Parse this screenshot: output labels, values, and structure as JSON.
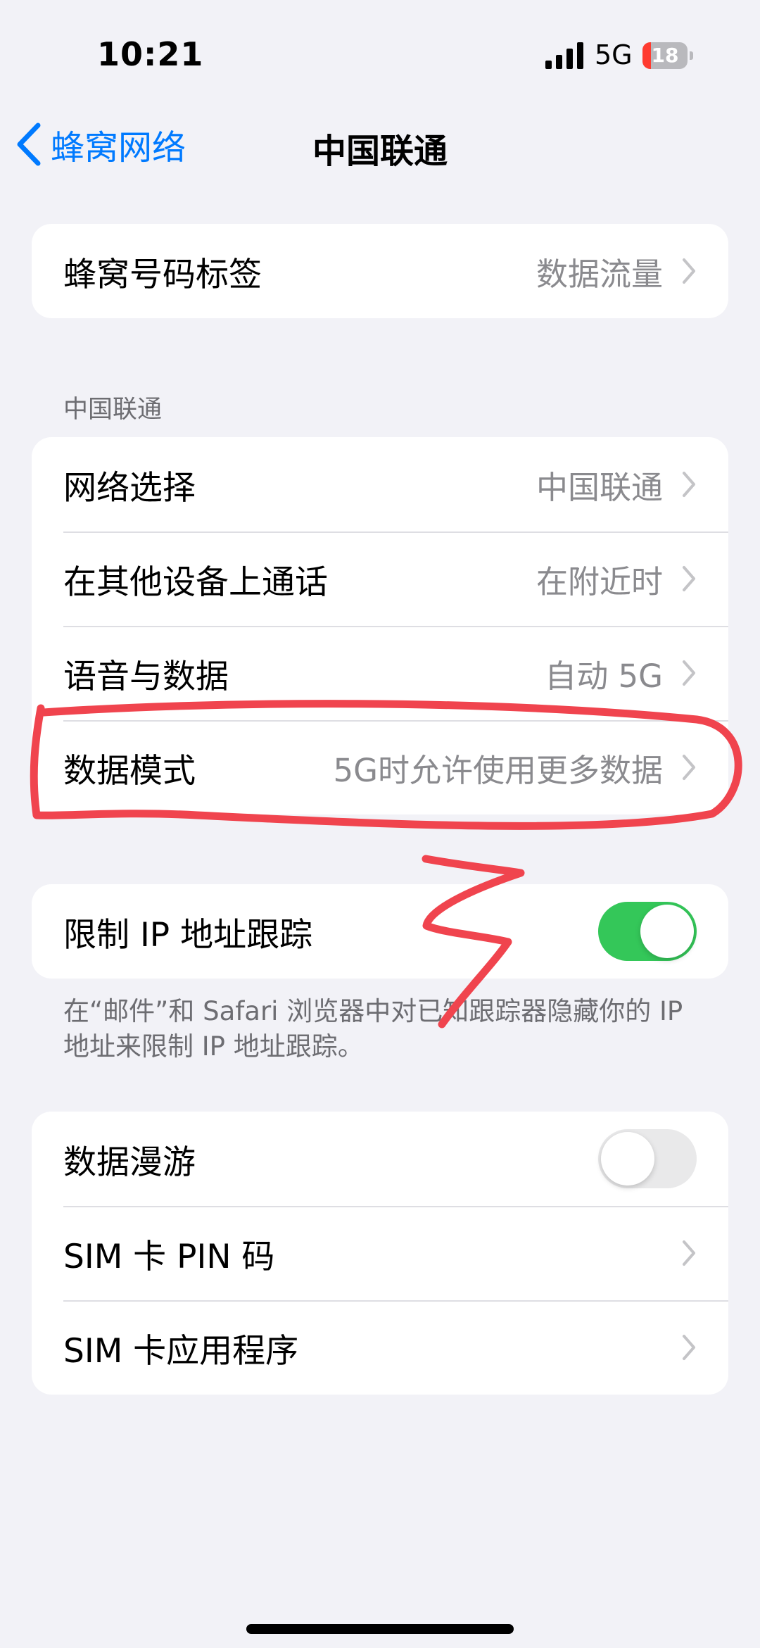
{
  "status_bar": {
    "time": "10:21",
    "network": "5G",
    "battery_level": "18",
    "battery_fraction": 0.18,
    "battery_color": "#ff3b30"
  },
  "nav": {
    "back_label": "蜂窝网络",
    "title": "中国联通"
  },
  "group1": {
    "rows": [
      {
        "label": "蜂窝号码标签",
        "value": "数据流量"
      }
    ]
  },
  "section2": {
    "header": "中国联通",
    "rows": [
      {
        "label": "网络选择",
        "value": "中国联通"
      },
      {
        "label": "在其他设备上通话",
        "value": "在附近时"
      },
      {
        "label": "语音与数据",
        "value": "自动 5G"
      },
      {
        "label": "数据模式",
        "value": "5G时允许使用更多数据"
      }
    ]
  },
  "section3": {
    "row": {
      "label": "限制 IP 地址跟踪",
      "toggle": "on"
    },
    "footer": "在“邮件”和 Safari 浏览器中对已知跟踪器隐藏你的 IP 地址来限制 IP 地址跟踪。"
  },
  "section4": {
    "rows": [
      {
        "label": "数据漫游",
        "toggle": "off"
      },
      {
        "label": "SIM 卡 PIN 码"
      },
      {
        "label": "SIM 卡应用程序"
      }
    ]
  },
  "colors": {
    "accent": "#007aff",
    "toggle_on": "#34c759",
    "annotation": "#f0444e",
    "background": "#f2f2f7"
  }
}
